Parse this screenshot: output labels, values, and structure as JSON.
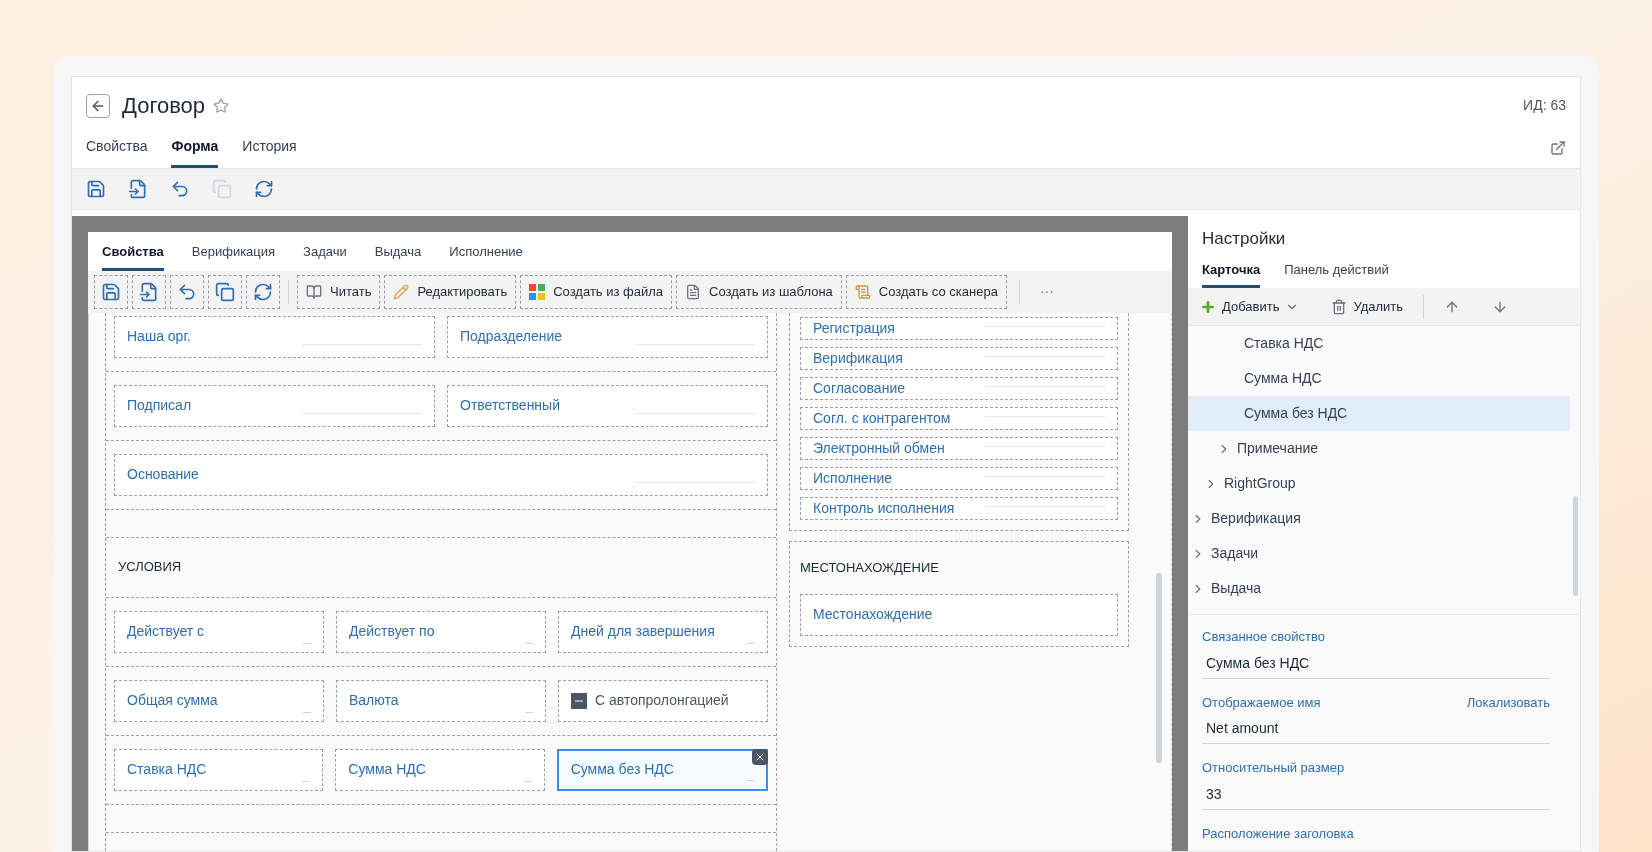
{
  "header": {
    "title": "Договор",
    "id_label": "ИД: 63",
    "favorite": false,
    "tabs": [
      {
        "label": "Свойства",
        "selected": false
      },
      {
        "label": "Форма",
        "selected": true
      },
      {
        "label": "История",
        "selected": false
      }
    ],
    "toolbar": [
      {
        "kind": "save",
        "disabled": false
      },
      {
        "kind": "save-as",
        "disabled": false
      },
      {
        "kind": "undo",
        "disabled": false
      },
      {
        "kind": "copy",
        "disabled": true
      },
      {
        "kind": "refresh",
        "disabled": false
      }
    ]
  },
  "form": {
    "tabs": [
      {
        "label": "Свойства",
        "selected": true
      },
      {
        "label": "Верификация",
        "selected": false
      },
      {
        "label": "Задачи",
        "selected": false
      },
      {
        "label": "Выдача",
        "selected": false
      },
      {
        "label": "Исполнение",
        "selected": false
      }
    ],
    "icon_buttons": [
      {
        "kind": "save",
        "disabled": false
      },
      {
        "kind": "save-as",
        "disabled": false
      },
      {
        "kind": "undo",
        "disabled": false
      },
      {
        "kind": "copy",
        "disabled": false
      },
      {
        "kind": "refresh",
        "disabled": false
      }
    ],
    "buttons": [
      {
        "kind": "read",
        "label": "Читать"
      },
      {
        "kind": "edit",
        "label": "Редактировать"
      },
      {
        "kind": "file",
        "label": "Создать из файла"
      },
      {
        "kind": "template",
        "label": "Создать из шаблона"
      },
      {
        "kind": "scanner",
        "label": "Создать со сканера"
      }
    ],
    "more": "···",
    "left": [
      {
        "kind": "row",
        "fields": [
          {
            "label": "Наша орг.",
            "kind": "lookup",
            "selected": false
          },
          {
            "label": "Подразделение",
            "kind": "lookup",
            "selected": false
          }
        ]
      },
      {
        "kind": "row",
        "fields": [
          {
            "label": "Подписал",
            "kind": "lookup",
            "selected": false
          },
          {
            "label": "Ответственный",
            "kind": "lookup",
            "selected": false
          }
        ]
      },
      {
        "kind": "row",
        "fields": [
          {
            "label": "Основание",
            "kind": "lookup",
            "selected": false
          }
        ]
      },
      {
        "kind": "spacer"
      },
      {
        "kind": "heading",
        "label": "УСЛОВИЯ"
      },
      {
        "kind": "row",
        "fields": [
          {
            "label": "Действует с",
            "kind": "short",
            "selected": false
          },
          {
            "label": "Действует по",
            "kind": "short",
            "selected": false
          },
          {
            "label": "Дней для завершения",
            "kind": "short",
            "selected": false
          }
        ]
      },
      {
        "kind": "row",
        "fields": [
          {
            "label": "Общая сумма",
            "kind": "short",
            "selected": false
          },
          {
            "label": "Валюта",
            "kind": "short",
            "selected": false
          },
          {
            "label": "С автопролонгацией",
            "kind": "checkbox",
            "indeterminate": true,
            "selected": false
          }
        ]
      },
      {
        "kind": "row",
        "fields": [
          {
            "label": "Ставка НДС",
            "kind": "short",
            "selected": false
          },
          {
            "label": "Сумма НДС",
            "kind": "short",
            "selected": false
          },
          {
            "label": "Сумма без НДС",
            "kind": "short",
            "selected": true
          }
        ]
      },
      {
        "kind": "spacer"
      },
      {
        "kind": "spacer"
      }
    ],
    "right": [
      {
        "label": "Регистрация"
      },
      {
        "label": "Верификация"
      },
      {
        "label": "Согласование"
      },
      {
        "label": "Согл. с контрагентом"
      },
      {
        "label": "Электронный обмен"
      },
      {
        "label": "Исполнение"
      },
      {
        "label": "Контроль исполнения"
      }
    ],
    "location": {
      "heading": "МЕСТОНАХОЖДЕНИЕ",
      "field": "Местонахождение"
    }
  },
  "settings": {
    "title": "Настройки",
    "tabs": [
      {
        "label": "Карточка",
        "selected": true
      },
      {
        "label": "Панель действий",
        "selected": false
      }
    ],
    "add": "Добавить",
    "delete": "Удалить",
    "tree": [
      {
        "children": [
          {
            "children": [
              {
                "children": [
                  {
                    "label": "Ставка НДС",
                    "selected": false
                  },
                  {
                    "label": "Сумма НДС",
                    "selected": false
                  },
                  {
                    "label": "Сумма без НДС",
                    "selected": true
                  }
                ]
              },
              {
                "label": "Примечание",
                "expanded": false,
                "selected": false
              }
            ]
          },
          {
            "label": "RightGroup",
            "expanded": false,
            "selected": false
          }
        ]
      },
      {
        "label": "Верификация",
        "expanded": false,
        "selected": false
      },
      {
        "label": "Задачи",
        "expanded": false,
        "selected": false
      },
      {
        "label": "Выдача",
        "expanded": false,
        "selected": false
      }
    ],
    "properties": [
      {
        "label": "Связанное свойство",
        "value": "Сумма без НДС"
      },
      {
        "label": "Отображаемое имя",
        "action": "Локализовать",
        "value": "Net amount"
      },
      {
        "label": "Относительный размер",
        "value": "33"
      },
      {
        "label": "Расположение заголовка"
      }
    ]
  }
}
